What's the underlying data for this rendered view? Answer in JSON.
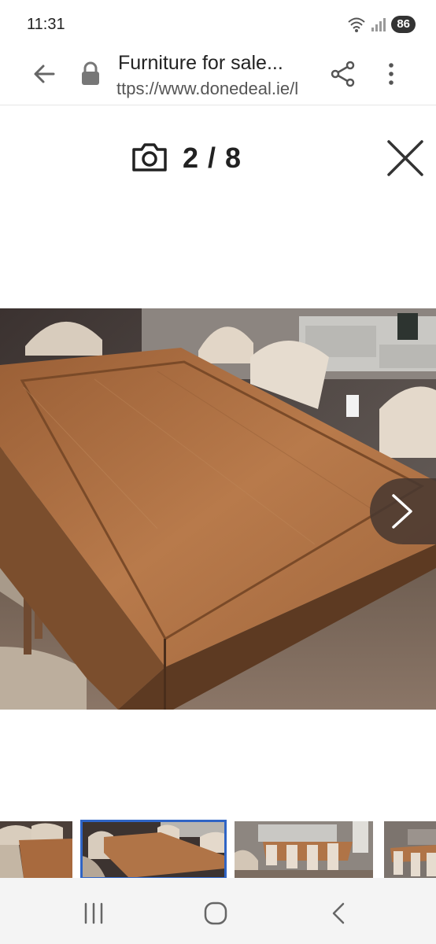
{
  "status_bar": {
    "time": "11:31",
    "battery": "86"
  },
  "browser": {
    "title": "Furniture for sale...",
    "url": "ttps://www.donedeal.ie/l"
  },
  "gallery": {
    "counter": "2 / 8",
    "current_index": 2,
    "total": 8,
    "selected_thumb_color": "#2f64c5"
  },
  "icons": {
    "back": "arrow-left-icon",
    "lock": "lock-icon",
    "share": "share-icon",
    "menu": "more-vertical-icon",
    "camera": "camera-icon",
    "close": "close-icon",
    "next": "chevron-right-icon"
  }
}
